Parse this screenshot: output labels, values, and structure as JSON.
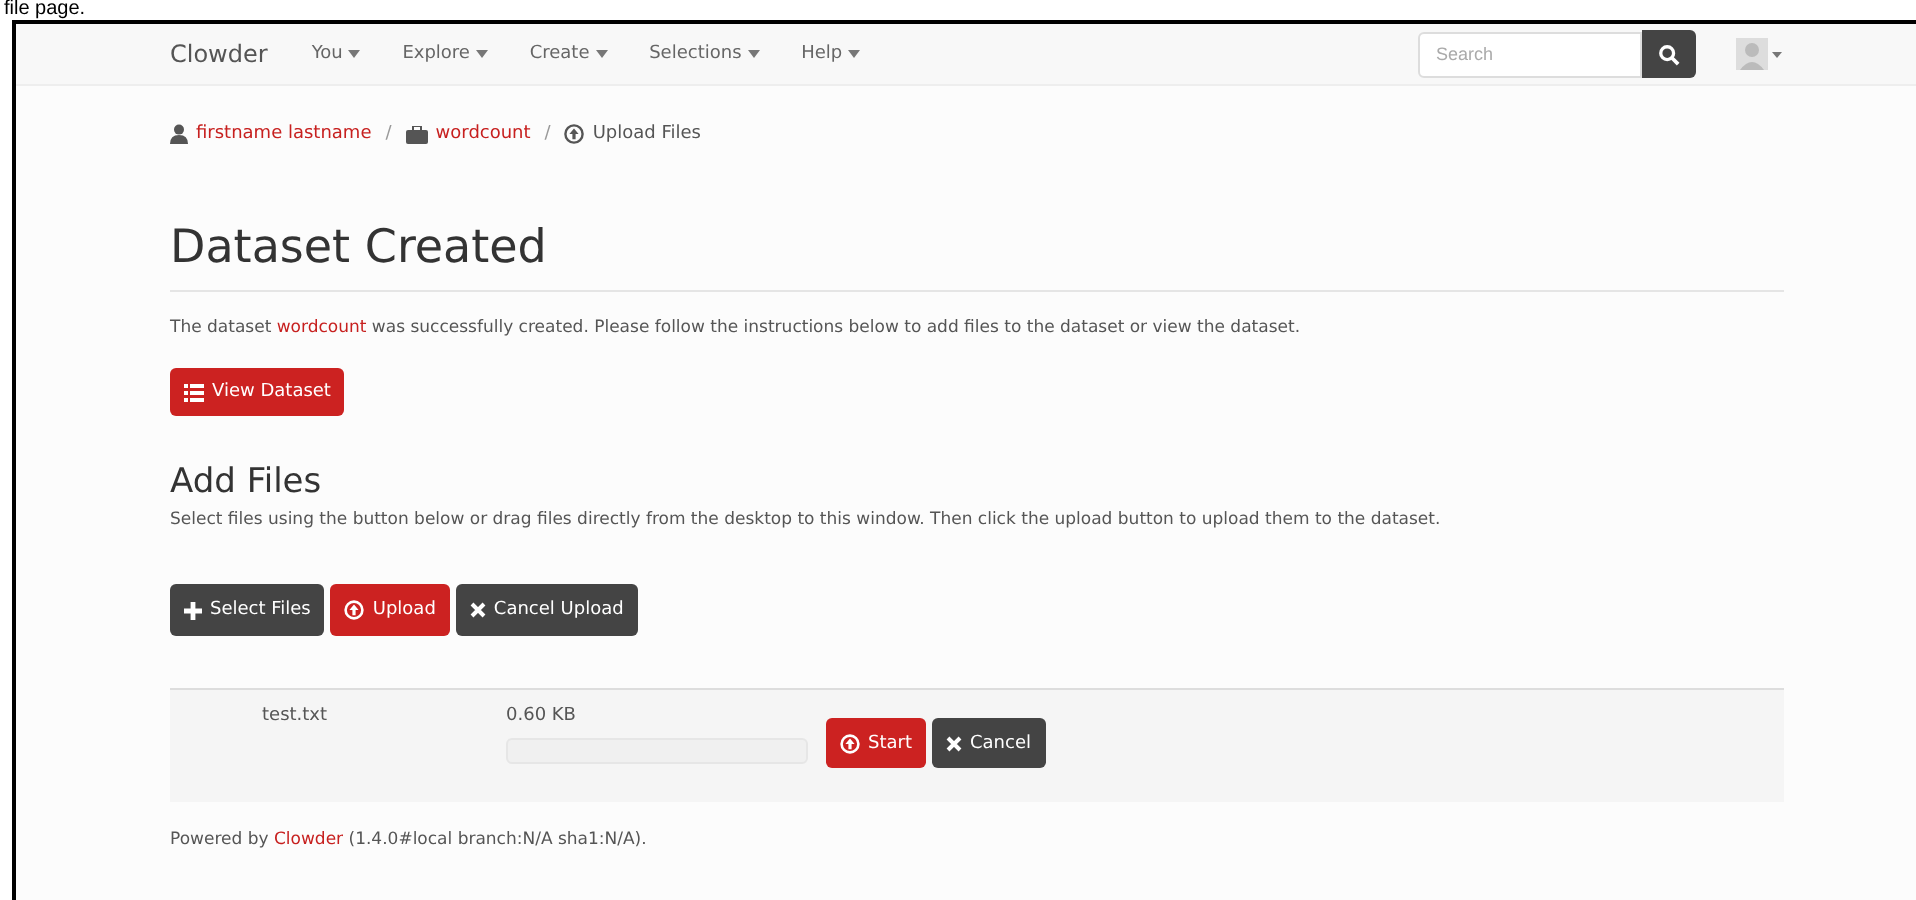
{
  "caption": "file page.",
  "navbar": {
    "brand": "Clowder",
    "menus": [
      {
        "label": "You"
      },
      {
        "label": "Explore"
      },
      {
        "label": "Create"
      },
      {
        "label": "Selections"
      },
      {
        "label": "Help"
      }
    ],
    "search": {
      "placeholder": "Search"
    }
  },
  "breadcrumb_separator": "/",
  "breadcrumb": [
    {
      "kind": "user",
      "label": "firstname lastname",
      "link": true
    },
    {
      "kind": "dataset",
      "label": "wordcount",
      "link": true
    },
    {
      "kind": "upload",
      "label": "Upload Files",
      "link": false
    }
  ],
  "heading": "Dataset Created",
  "message": {
    "before": "The dataset ",
    "link": "wordcount",
    "after": " was successfully created. Please follow the instructions below to add files to the dataset or view the dataset."
  },
  "view_button": "View Dataset",
  "add_files": {
    "title": "Add Files",
    "description": "Select files using the button below or drag files directly from the desktop to this window. Then click the upload button to upload them to the dataset."
  },
  "actions": [
    {
      "kind": "plus",
      "label": "Select Files"
    },
    {
      "kind": "upload",
      "label": "Upload"
    },
    {
      "kind": "cancel",
      "label": "Cancel Upload"
    }
  ],
  "files": [
    {
      "name": "test.txt",
      "size": "0.60 KB",
      "level": 0,
      "start": "Start",
      "cancel": "Cancel"
    }
  ],
  "footer": {
    "before": "Powered by ",
    "link": "Clowder",
    "after": " (1.4.0#local branch:N/A sha1:N/A)."
  }
}
